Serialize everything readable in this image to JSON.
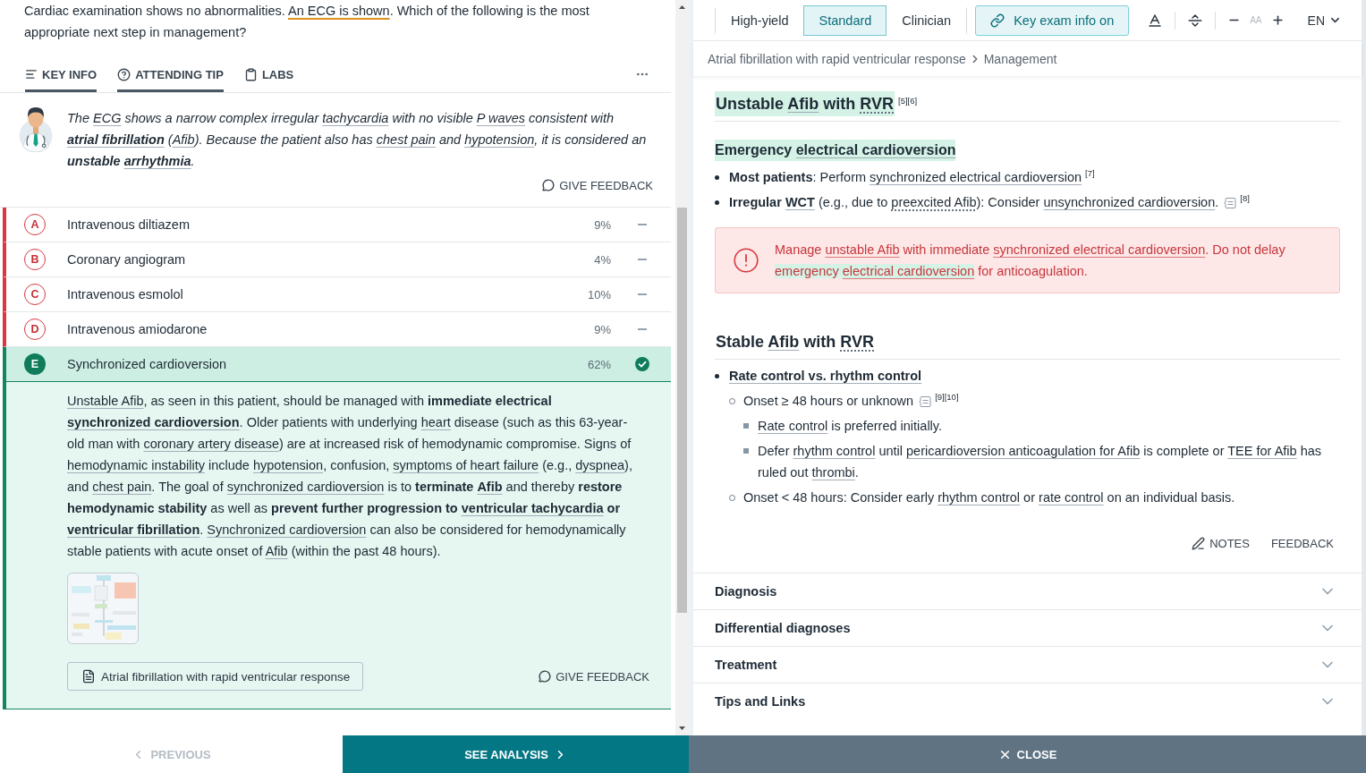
{
  "question": {
    "segments": [
      "Cardiac examination shows no abnormalities. ",
      {
        "text": "An ECG is shown",
        "kind": "media"
      },
      ". Which of the following is the most appropriate next step in management?"
    ]
  },
  "tabs": [
    {
      "label": "KEY INFO",
      "kind": "info",
      "selected": true
    },
    {
      "label": "ATTENDING TIP",
      "kind": "tip",
      "selected": true
    },
    {
      "label": "LABS",
      "kind": "labs",
      "selected": false
    }
  ],
  "attending_tip": {
    "segments": [
      "The ",
      {
        "text": "ECG",
        "kind": "link"
      },
      " shows a narrow complex irregular ",
      {
        "text": "tachycardia",
        "kind": "link"
      },
      " with no visible ",
      {
        "text": "P waves",
        "kind": "link"
      },
      " consistent with ",
      {
        "text": "**atrial fibrillation**",
        "kind": "link"
      },
      " (",
      {
        "text": "Afib",
        "kind": "link"
      },
      "). Because the patient also has ",
      {
        "text": "chest pain",
        "kind": "link"
      },
      " and ",
      {
        "text": "hypotension",
        "kind": "link"
      },
      ", it is considered an **unstable** ",
      {
        "text": "**arrhythmia**",
        "kind": "link"
      },
      "."
    ],
    "feedback": "GIVE FEEDBACK"
  },
  "answers": [
    {
      "letter": "A",
      "text": "Intravenous diltiazem",
      "percent": "9%",
      "correct": false
    },
    {
      "letter": "B",
      "text": "Coronary angiogram",
      "percent": "4%",
      "correct": false
    },
    {
      "letter": "C",
      "text": "Intravenous esmolol",
      "percent": "10%",
      "correct": false
    },
    {
      "letter": "D",
      "text": "Intravenous amiodarone",
      "percent": "9%",
      "correct": false
    },
    {
      "letter": "E",
      "text": "Synchronized cardioversion",
      "percent": "62%",
      "correct": true
    }
  ],
  "explanation": {
    "segments": [
      {
        "text": "Unstable Afib",
        "kind": "link"
      },
      ", as seen in this patient, should be managed with **immediate electrical** ",
      {
        "text": "**synchronized cardioversion**",
        "kind": "link"
      },
      ". Older patients with underlying ",
      {
        "text": "heart",
        "kind": "link"
      },
      " disease (such as this 63-year-old man with ",
      {
        "text": "coronary artery disease",
        "kind": "link"
      },
      ") are at increased risk of hemodynamic compromise. Signs of ",
      {
        "text": "hemodynamic instability",
        "kind": "link"
      },
      " include ",
      {
        "text": "hypotension",
        "kind": "link"
      },
      ", confusion, ",
      {
        "text": "symptoms of heart failure",
        "kind": "link"
      },
      " (e.g., ",
      {
        "text": "dyspnea",
        "kind": "link"
      },
      "), and ",
      {
        "text": "chest pain",
        "kind": "link"
      },
      ". The goal of ",
      {
        "text": "synchronized cardioversion",
        "kind": "link"
      },
      " is to **terminate** ",
      {
        "text": "**Afib**",
        "kind": "link"
      },
      " and thereby **restore hemodynamic stability** as well as **prevent further progression to** ",
      {
        "text": "**ventricular tachycardia**",
        "kind": "link"
      },
      " **or** ",
      {
        "text": "**ventricular fibrillation**",
        "kind": "link"
      },
      ". ",
      {
        "text": "Synchronized cardioversion",
        "kind": "link"
      },
      " can also be considered for hemodynamically stable patients with acute onset of ",
      {
        "text": "Afib",
        "kind": "link"
      },
      " (within the past 48 hours)."
    ],
    "article_link": "Atrial fibrillation with rapid ventricular response",
    "feedback": "GIVE FEEDBACK"
  },
  "navigation": {
    "previous": {
      "label": "PREVIOUS",
      "disabled": true
    },
    "next": "SEE ANALYSIS",
    "close": "CLOSE"
  },
  "article": {
    "modes": [
      {
        "label": "High-yield",
        "selected": false
      },
      {
        "label": "Standard",
        "selected": true
      },
      {
        "label": "Clinician",
        "selected": false
      }
    ],
    "key_exam_info": {
      "label": "Key exam info on",
      "on": true
    },
    "font_size_label": "AA",
    "language": "EN",
    "breadcrumb": [
      "Atrial fibrillation with rapid ventricular response",
      "Management"
    ],
    "sections": [
      {
        "title": [
          "Unstable ",
          {
            "text": "Afib",
            "kind": "link"
          },
          " with ",
          {
            "text": "RVR",
            "kind": "abbr"
          }
        ],
        "refs": "[5][6]",
        "highlighted": true,
        "blocks": [
          {
            "kind": "subheading",
            "segments": [
              "Emergency ",
              {
                "text": "electrical cardioversion",
                "kind": "link"
              }
            ],
            "highlighted": true
          },
          {
            "kind": "list",
            "items": [
              {
                "segments": [
                  "**Most patients**: Perform ",
                  {
                    "text": "synchronized electrical cardioversion",
                    "kind": "link"
                  }
                ],
                "refs": "[7]",
                "note": false
              },
              {
                "segments": [
                  "**Irregular** ",
                  {
                    "text": "**WCT**",
                    "kind": "link"
                  },
                  " (e.g., due to ",
                  {
                    "text": "preexcited Afib",
                    "kind": "abbr"
                  },
                  "): Consider ",
                  {
                    "text": "unsynchronized cardioversion",
                    "kind": "link"
                  },
                  "."
                ],
                "refs": "[8]",
                "note": true
              }
            ]
          },
          {
            "kind": "callout",
            "segments": [
              "Manage ",
              {
                "text": "unstable Afib",
                "kind": "link"
              },
              " with immediate ",
              {
                "text": "synchronized electrical cardioversion",
                "kind": "link"
              },
              ". Do not delay ",
              {
                "text": "emergency ",
                "kind": "mark"
              },
              {
                "text": "electrical cardioversion",
                "kind": "marklink"
              },
              " for anticoagulation."
            ]
          }
        ]
      },
      {
        "title": [
          "Stable ",
          {
            "text": "Afib",
            "kind": "link"
          },
          " with ",
          {
            "text": "RVR",
            "kind": "abbr"
          }
        ],
        "highlighted": false,
        "blocks": [
          {
            "kind": "list",
            "items": [
              {
                "segments": [
                  {
                    "text": "**Rate control vs. rhythm control**",
                    "kind": "link"
                  }
                ],
                "note": false,
                "children": [
                  {
                    "segments": [
                      "Onset ≥ 48 hours or unknown"
                    ],
                    "note": true,
                    "refs": "[9][10]",
                    "children": [
                      {
                        "segments": [
                          {
                            "text": "Rate control",
                            "kind": "link"
                          },
                          " is preferred initially."
                        ],
                        "note": false
                      },
                      {
                        "segments": [
                          "Defer ",
                          {
                            "text": "rhythm control",
                            "kind": "link"
                          },
                          " until ",
                          {
                            "text": "pericardioversion anticoagulation for Afib",
                            "kind": "link"
                          },
                          " is complete or ",
                          {
                            "text": "TEE for Afib",
                            "kind": "link"
                          },
                          " has ruled out ",
                          {
                            "text": "thrombi",
                            "kind": "link"
                          },
                          "."
                        ],
                        "note": false
                      }
                    ]
                  },
                  {
                    "segments": [
                      "Onset < 48 hours: Consider early ",
                      {
                        "text": "rhythm control",
                        "kind": "link"
                      },
                      " or ",
                      {
                        "text": "rate control",
                        "kind": "link"
                      },
                      " on an individual basis."
                    ],
                    "note": false
                  }
                ]
              }
            ]
          }
        ]
      }
    ],
    "actions": {
      "notes": "NOTES",
      "feedback": "FEEDBACK"
    },
    "accordion": [
      {
        "title": "Diagnosis",
        "expanded": false
      },
      {
        "title": "Differential diagnoses",
        "expanded": false
      },
      {
        "title": "Treatment",
        "expanded": false
      },
      {
        "title": "Tips and Links",
        "expanded": false
      }
    ]
  }
}
